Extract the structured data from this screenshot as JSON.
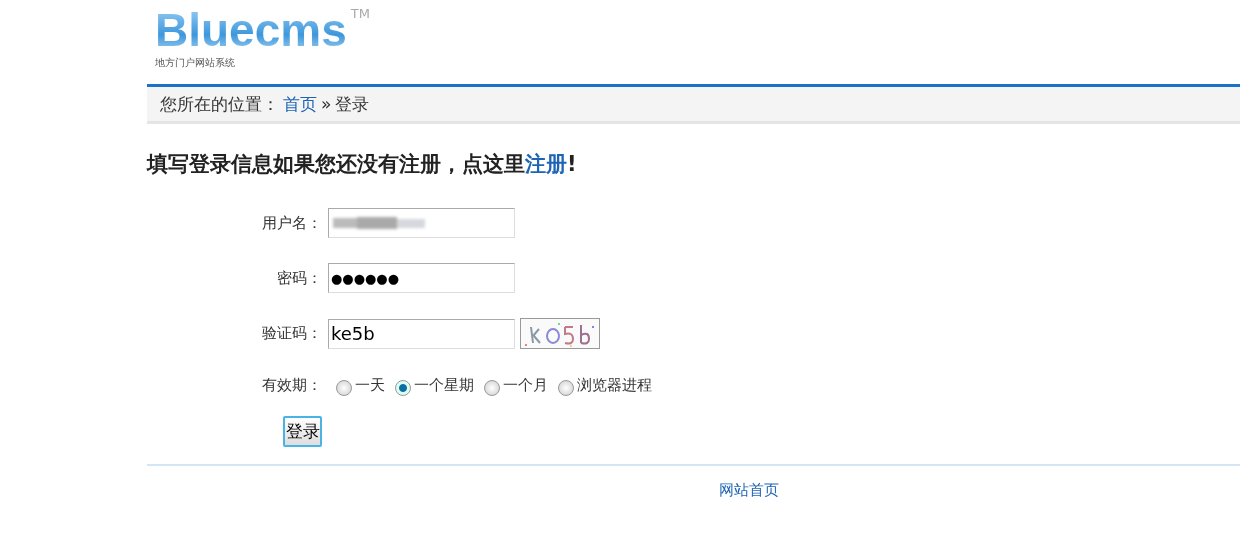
{
  "logo": {
    "name": "Bluecms",
    "trademark": "TM",
    "tagline": "地方门户网站系统"
  },
  "breadcrumb": {
    "prefix": "您所在的位置：",
    "links": [
      {
        "label": "首页"
      }
    ],
    "separator": "»",
    "current": "登录"
  },
  "heading": {
    "text": "填写登录信息如果您还没有注册，点这里",
    "link": "注册",
    "suffix": "!"
  },
  "form": {
    "fields": [
      {
        "kind": "text",
        "label": "用户名：",
        "redacted": true
      },
      {
        "kind": "password",
        "label": "密码：",
        "value": "●●●●●●"
      },
      {
        "kind": "captcha",
        "label": "验证码：",
        "value": "ke5b"
      }
    ],
    "validity": {
      "label": "有效期：",
      "options": [
        {
          "label": "一天",
          "selected": false
        },
        {
          "label": "一个星期",
          "selected": true
        },
        {
          "label": "一个月",
          "selected": false
        },
        {
          "label": "浏览器进程",
          "selected": false
        }
      ]
    },
    "submit": "登录"
  },
  "footer": {
    "links": [
      "网站首页"
    ]
  }
}
